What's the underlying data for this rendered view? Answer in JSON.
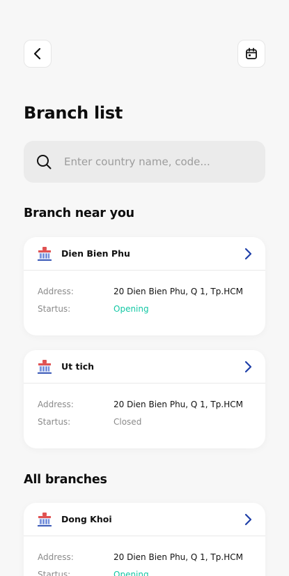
{
  "header": {
    "back_icon": "chevron-left-icon",
    "calendar_icon": "calendar-icon"
  },
  "page": {
    "title": "Branch list"
  },
  "search": {
    "icon": "search-icon",
    "placeholder": "Enter country name, code..."
  },
  "sections": {
    "near_title": "Branch near you",
    "all_title": "All branches"
  },
  "labels": {
    "address": "Address:",
    "status": "Startus:"
  },
  "near_branches": [
    {
      "name": "Dien Bien Phu",
      "address": "20 Dien Bien Phu, Q 1, Tp.HCM",
      "status": "Opening"
    },
    {
      "name": "Ut tich",
      "address": "20 Dien Bien Phu, Q 1, Tp.HCM",
      "status": "Closed"
    }
  ],
  "all_branches": [
    {
      "name": "Dong Khoi",
      "address": "20 Dien Bien Phu, Q 1, Tp.HCM",
      "status": "Opening"
    }
  ],
  "colors": {
    "background": "#f7f7f7",
    "status_open": "#12c7a4",
    "status_closed": "#8a8a8a",
    "chevron": "#1f3fa8",
    "branch_icon_red": "#e05252",
    "branch_icon_blue": "#5b7bd5"
  }
}
